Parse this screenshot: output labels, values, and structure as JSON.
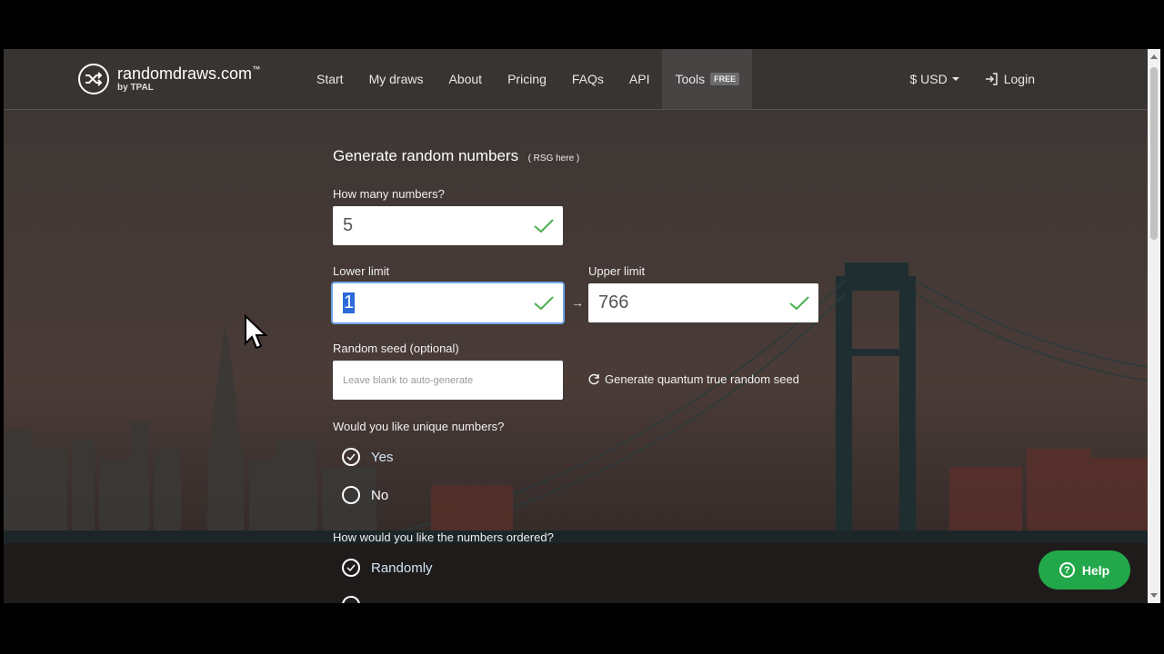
{
  "nav": {
    "logo_name": "randomdraws.com",
    "logo_tm": "™",
    "logo_by": "by TPAL",
    "links": [
      "Start",
      "My draws",
      "About",
      "Pricing",
      "FAQs",
      "API"
    ],
    "tools_label": "Tools",
    "tools_badge": "FREE",
    "currency": "$ USD",
    "login": "Login"
  },
  "form": {
    "title": "Generate random numbers",
    "rsg_link": "( RSG here )",
    "how_many_label": "How many numbers?",
    "how_many_value": "5",
    "lower_label": "Lower limit",
    "lower_value": "1",
    "upper_label": "Upper limit",
    "upper_value": "766",
    "seed_label": "Random seed (optional)",
    "seed_placeholder": "Leave blank to auto-generate",
    "quantum_label": "Generate quantum true random seed",
    "unique_question": "Would you like unique numbers?",
    "unique_options": [
      {
        "label": "Yes",
        "checked": true
      },
      {
        "label": "No",
        "checked": false
      }
    ],
    "order_question": "How would you like the numbers ordered?",
    "order_options": [
      {
        "label": "Randomly",
        "checked": true
      }
    ]
  },
  "help_label": "Help",
  "colors": {
    "accent_green": "#22a84a",
    "check_green": "#4caf50",
    "focus_blue": "#6fa3e6"
  }
}
